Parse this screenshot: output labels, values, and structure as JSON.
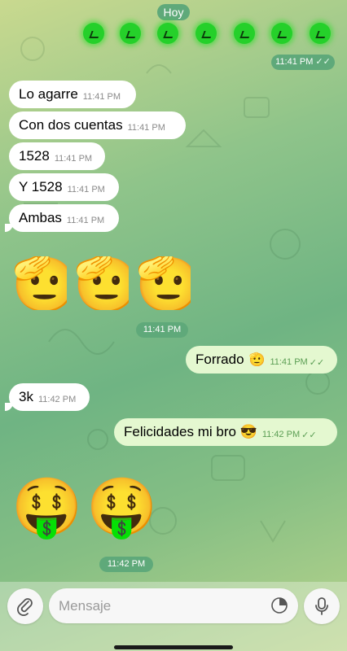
{
  "date_label": "Hoy",
  "status_count": 7,
  "first_time": {
    "time": "11:41 PM",
    "ticks": "✓✓"
  },
  "messages_in": [
    {
      "text": "Lo agarre",
      "time": "11:41 PM"
    },
    {
      "text": "Con dos cuentas",
      "time": "11:41 PM"
    },
    {
      "text": "1528",
      "time": "11:41 PM"
    },
    {
      "text": "Y 1528",
      "time": "11:41 PM"
    },
    {
      "text": "Ambas",
      "time": "11:41 PM"
    }
  ],
  "salute_emoji": "🫡",
  "salute_time": "11:41 PM",
  "msg_forrado": {
    "text": "Forrado",
    "emoji": "🫡",
    "time": "11:41 PM",
    "ticks": "✓✓"
  },
  "msg_3k": {
    "text": "3k",
    "time": "11:42 PM"
  },
  "msg_felicidades": {
    "text": "Felicidades mi bro 😎",
    "time": "11:42 PM",
    "ticks": "✓✓"
  },
  "money_emoji": "🤑",
  "money_time": "11:42 PM",
  "input": {
    "placeholder": "Mensaje"
  },
  "icons": {
    "attach": "paperclip-icon",
    "sticker": "sticker-icon",
    "mic": "microphone-icon"
  }
}
